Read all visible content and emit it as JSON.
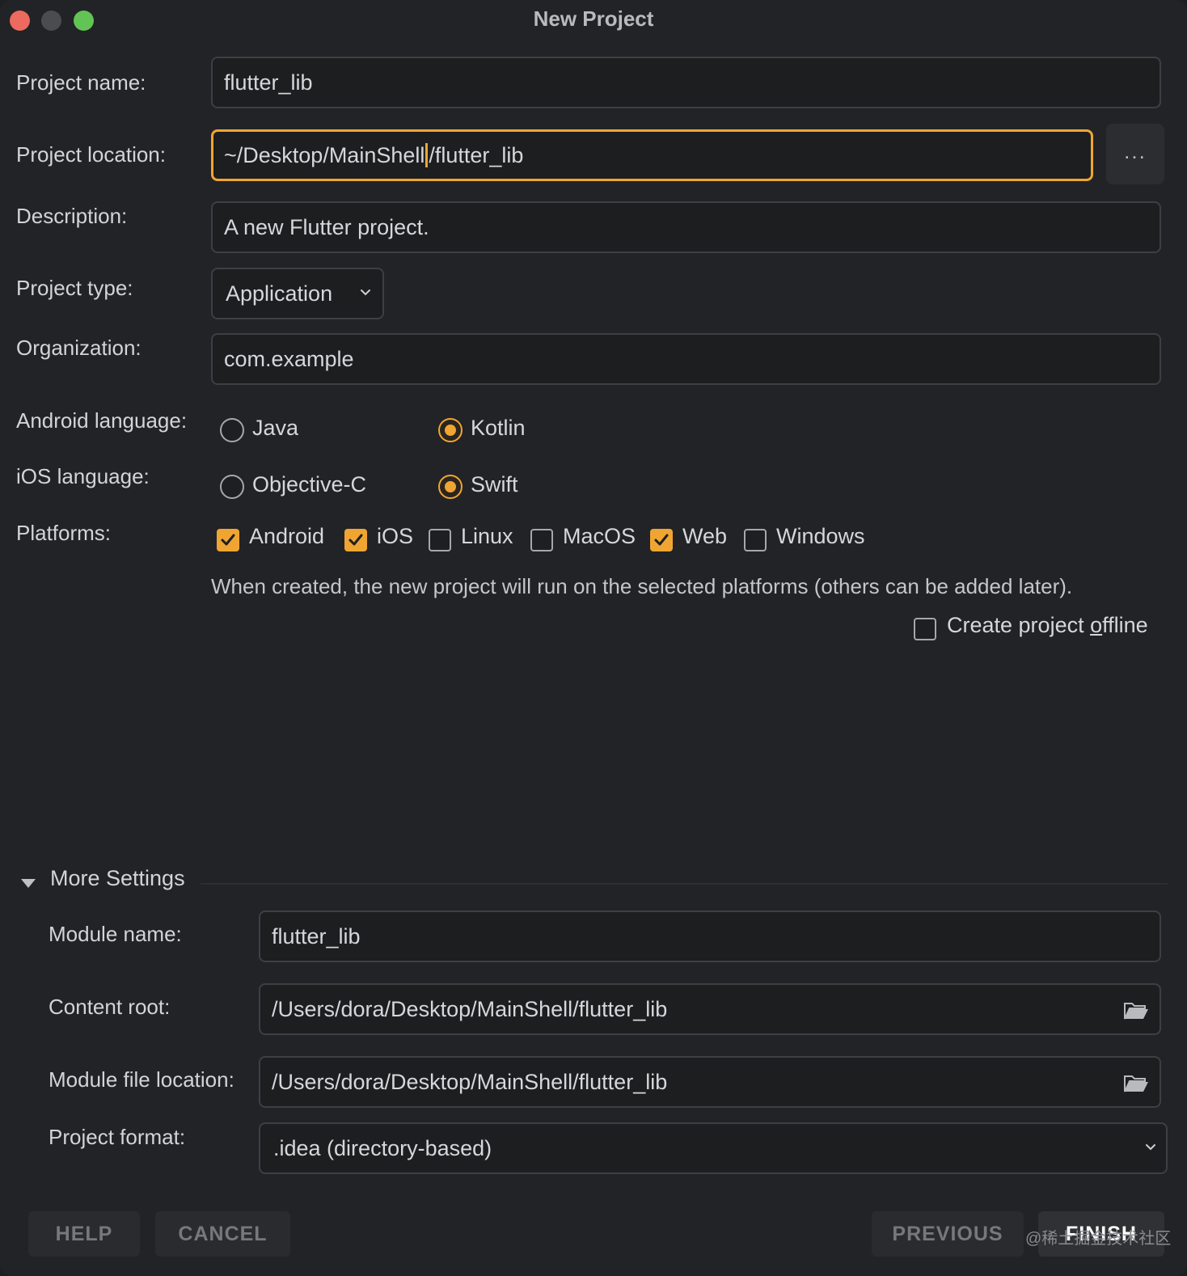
{
  "window": {
    "title": "New Project"
  },
  "form": {
    "project_name": {
      "label": "Project name:",
      "value": "flutter_lib"
    },
    "project_location": {
      "label": "Project location:",
      "value_before_caret": "~/Desktop/MainShell",
      "value_after_caret": "/flutter_lib",
      "browse_label": "..."
    },
    "description": {
      "label": "Description:",
      "value": "A new Flutter project."
    },
    "project_type": {
      "label": "Project type:",
      "selected": "Application"
    },
    "organization": {
      "label": "Organization:",
      "value": "com.example"
    },
    "android_language": {
      "label": "Android language:",
      "options": [
        "Java",
        "Kotlin"
      ],
      "selected": "Kotlin"
    },
    "ios_language": {
      "label": "iOS language:",
      "options": [
        "Objective-C",
        "Swift"
      ],
      "selected": "Swift"
    },
    "platforms": {
      "label": "Platforms:",
      "items": [
        {
          "name": "Android",
          "checked": true
        },
        {
          "name": "iOS",
          "checked": true
        },
        {
          "name": "Linux",
          "checked": false
        },
        {
          "name": "MacOS",
          "checked": false
        },
        {
          "name": "Web",
          "checked": true
        },
        {
          "name": "Windows",
          "checked": false
        }
      ],
      "hint": "When created, the new project will run on the selected platforms (others can be added later)."
    },
    "offline": {
      "label_before": "Create project ",
      "label_underlined": "o",
      "label_after": "ffline",
      "checked": false
    }
  },
  "more_settings": {
    "title": "More Settings",
    "module_name": {
      "label": "Module name:",
      "value": "flutter_lib"
    },
    "content_root": {
      "label": "Content root:",
      "value": "/Users/dora/Desktop/MainShell/flutter_lib"
    },
    "module_file_location": {
      "label": "Module file location:",
      "value": "/Users/dora/Desktop/MainShell/flutter_lib"
    },
    "project_format": {
      "label": "Project format:",
      "selected": ".idea (directory-based)"
    }
  },
  "buttons": {
    "help": "HELP",
    "cancel": "CANCEL",
    "previous": "PREVIOUS",
    "finish": "FINISH"
  },
  "watermark": "@稀土掘金技术社区",
  "colors": {
    "accent": "#f0a532",
    "background": "#222326",
    "field_bg": "#1d1e20",
    "border": "#3e3f43"
  }
}
